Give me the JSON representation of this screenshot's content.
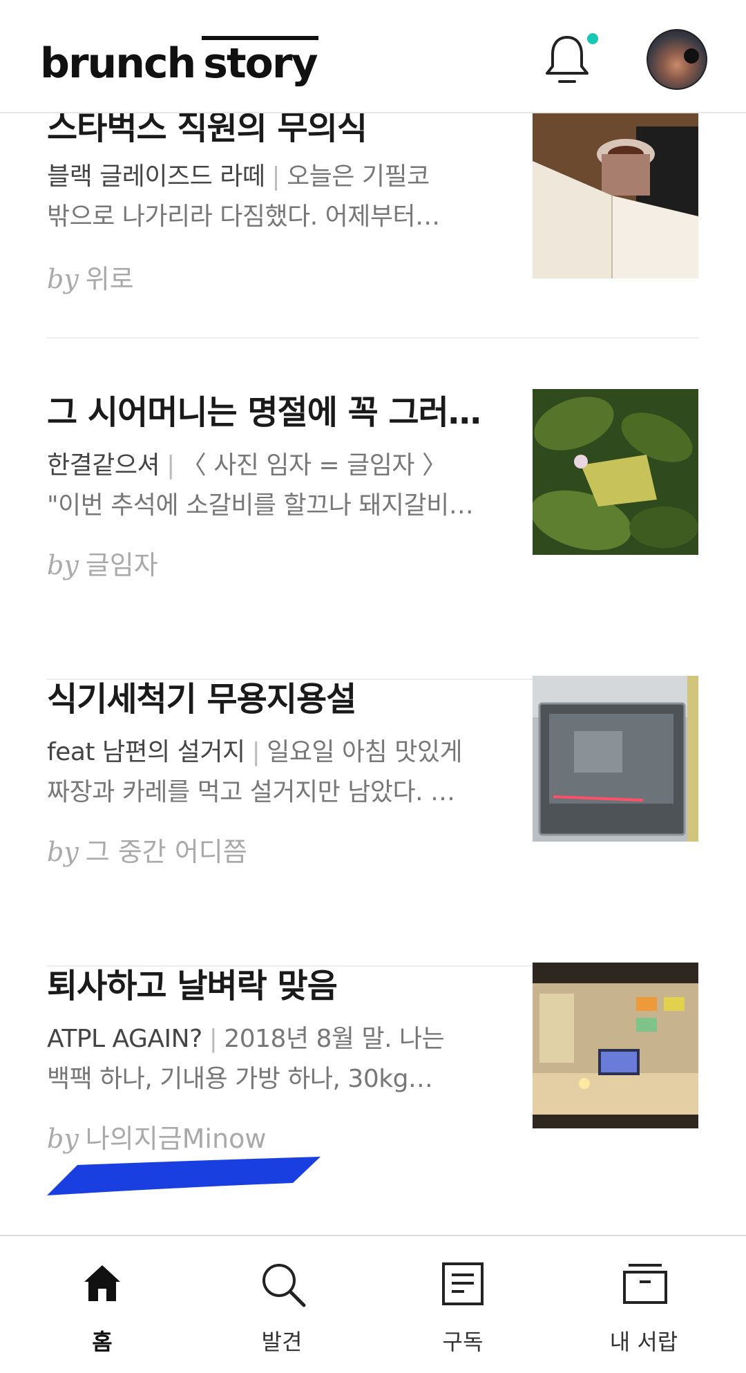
{
  "header": {
    "logo_part1": "brunch",
    "logo_part2": "story",
    "notification_badge_color": "#18c7b5"
  },
  "articles": [
    {
      "title": "스타벅스 직원의 무의식",
      "subtitle": "블랙 글레이즈드 라떼",
      "excerpt_line1": "오늘은 기필코",
      "excerpt_line2": "밖으로 나가리라 다짐했다. 어제부터…",
      "by": "by",
      "author": "위로",
      "thumbnail": "coffee-and-book"
    },
    {
      "title": "그 시어머니는 명절에 꼭 그러시…",
      "subtitle": "한결같으셔",
      "excerpt_line1": "〈 사진 임자 = 글임자 〉",
      "excerpt_line2": "\"이번 추석에 소갈비를 할끄나 돼지갈비…",
      "by": "by",
      "author": "글임자",
      "thumbnail": "butterfly-on-leaf"
    },
    {
      "title": "식기세척기 무용지용설",
      "subtitle": "feat 남편의 설거지",
      "excerpt_line1": "일요일 아침 맛있게",
      "excerpt_line2": "짜장과 카레를 먹고 설거지만 남았다. …",
      "by": "by",
      "author": "그 중간 어디쯤",
      "thumbnail": "dishwasher"
    },
    {
      "title": "퇴사하고 날벼락 맞음",
      "subtitle": "ATPL AGAIN?",
      "excerpt_line1": "2018년 8월 말. 나는",
      "excerpt_line2": "백팩 하나, 기내용 가방 하나, 30kg…",
      "by": "by",
      "author": "나의지금Minow",
      "thumbnail": "study-desk"
    }
  ],
  "annotation_color": "#1a3fe0",
  "bottom_nav": [
    {
      "label": "홈",
      "icon": "home-icon",
      "active": true
    },
    {
      "label": "발견",
      "icon": "search-icon",
      "active": false
    },
    {
      "label": "구독",
      "icon": "document-icon",
      "active": false
    },
    {
      "label": "내 서랍",
      "icon": "drawer-icon",
      "active": false
    }
  ]
}
